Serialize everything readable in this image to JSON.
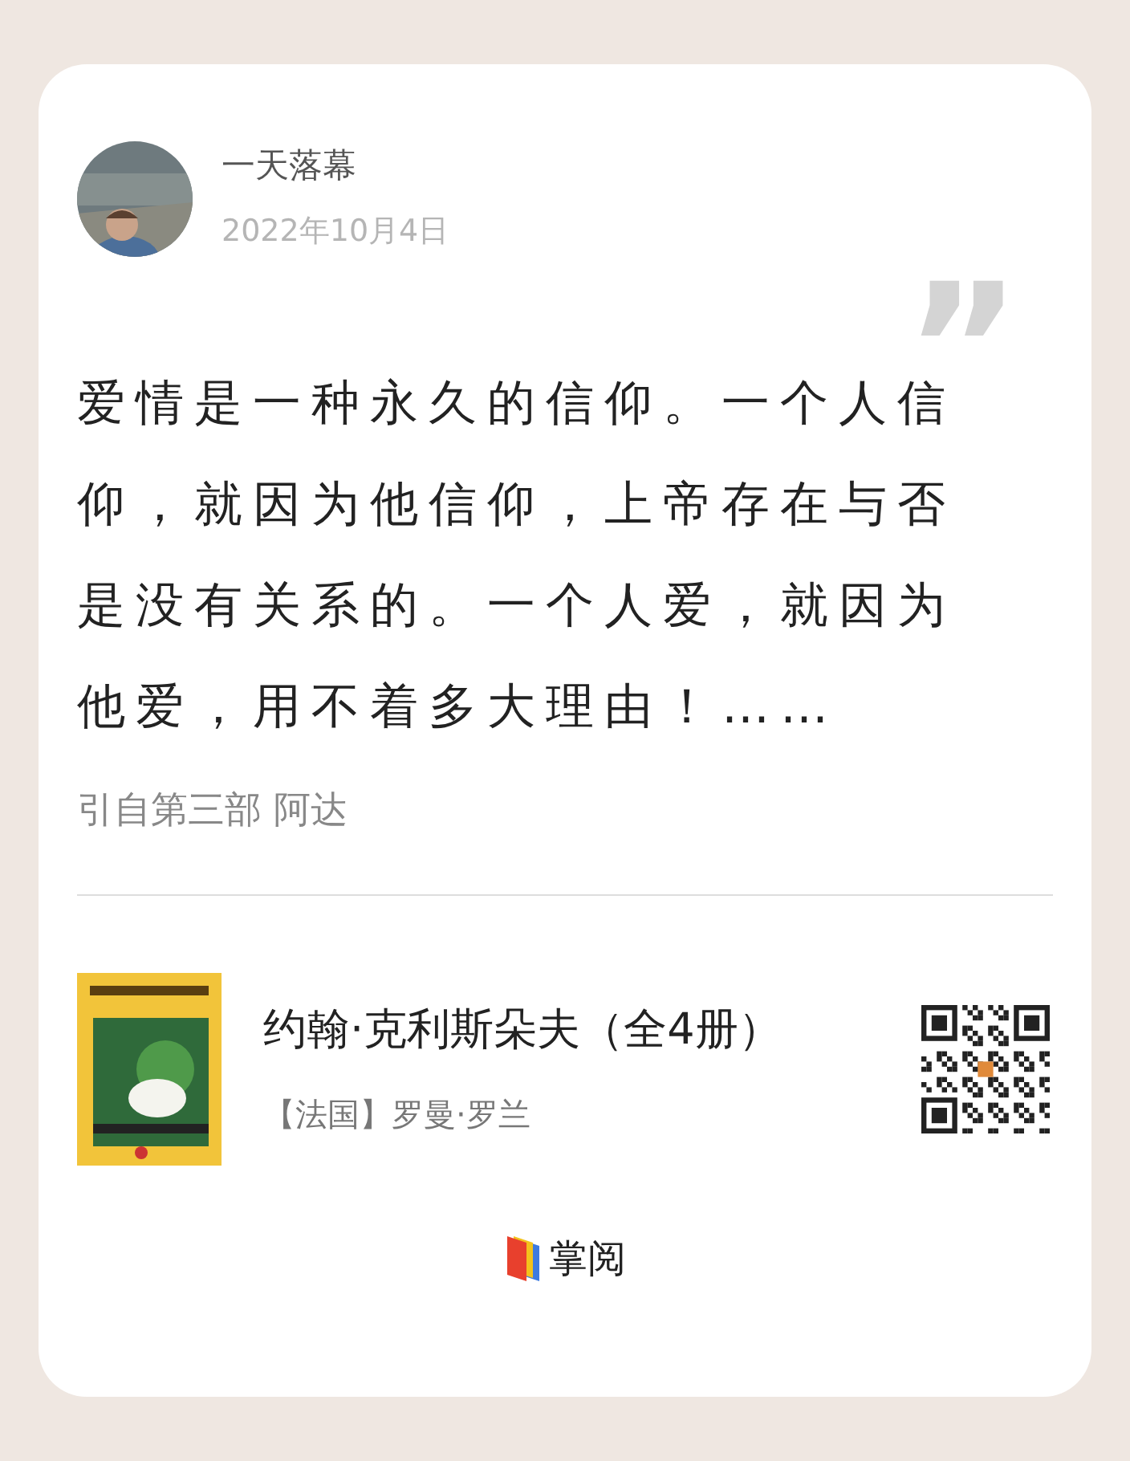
{
  "author": {
    "name": "一天落幕",
    "date": "2022年10月4日"
  },
  "quote_mark": "”",
  "quote": "爱情是一种永久的信仰。一个人信仰，就因为他信仰，上帝存在与否是没有关系的。一个人爱，就因为他爱，用不着多大理由！……",
  "source": "引自第三部 阿达",
  "book": {
    "title": "约翰·克利斯朵夫（全4册）",
    "author": "【法国】罗曼·罗兰"
  },
  "brand": "掌阅"
}
